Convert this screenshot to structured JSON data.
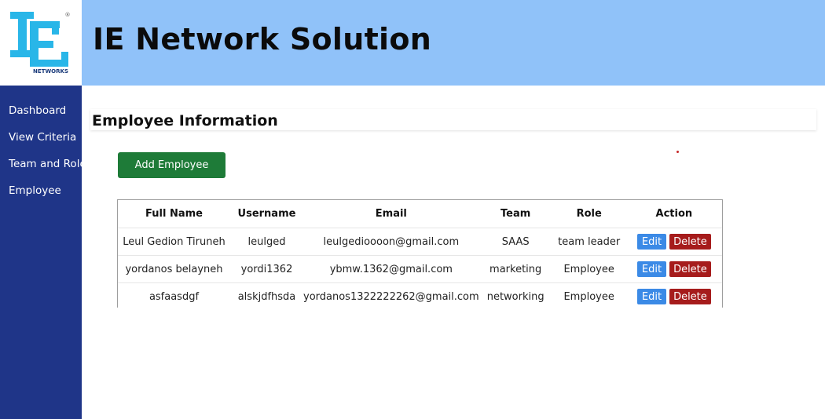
{
  "brand": {
    "logo_letters": "IE",
    "logo_subtext": "NETWORKS",
    "registered_mark": "®",
    "logo_color": "#29b6e8"
  },
  "header": {
    "title": "IE Network Solution",
    "background": "#90c2f9"
  },
  "sidebar": {
    "background": "#1f3588",
    "items": [
      {
        "label": "Dashboard"
      },
      {
        "label": "View Criteria"
      },
      {
        "label": "Team and Role"
      },
      {
        "label": "Employee"
      }
    ]
  },
  "main": {
    "section_title": "Employee Information",
    "add_button_label": "Add Employee",
    "table": {
      "columns": [
        "Full Name",
        "Username",
        "Email",
        "Team",
        "Role",
        "Action"
      ],
      "rows": [
        {
          "full_name": "Leul Gedion Tiruneh",
          "username": "leulged",
          "email": "leulgedioooon@gmail.com",
          "team": "SAAS",
          "role": "team leader"
        },
        {
          "full_name": "yordanos belayneh",
          "username": "yordi1362",
          "email": "ybmw.1362@gmail.com",
          "team": "marketing",
          "role": "Employee"
        },
        {
          "full_name": "asfaasdgf",
          "username": "alskjdfhsda",
          "email": "yordanos1322222262@gmail.com",
          "team": "networking",
          "role": "Employee"
        }
      ],
      "edit_label": "Edit",
      "delete_label": "Delete"
    }
  },
  "colors": {
    "add_button": "#1e7b38",
    "edit_button": "#3b8ae6",
    "delete_button": "#a61c1c"
  }
}
